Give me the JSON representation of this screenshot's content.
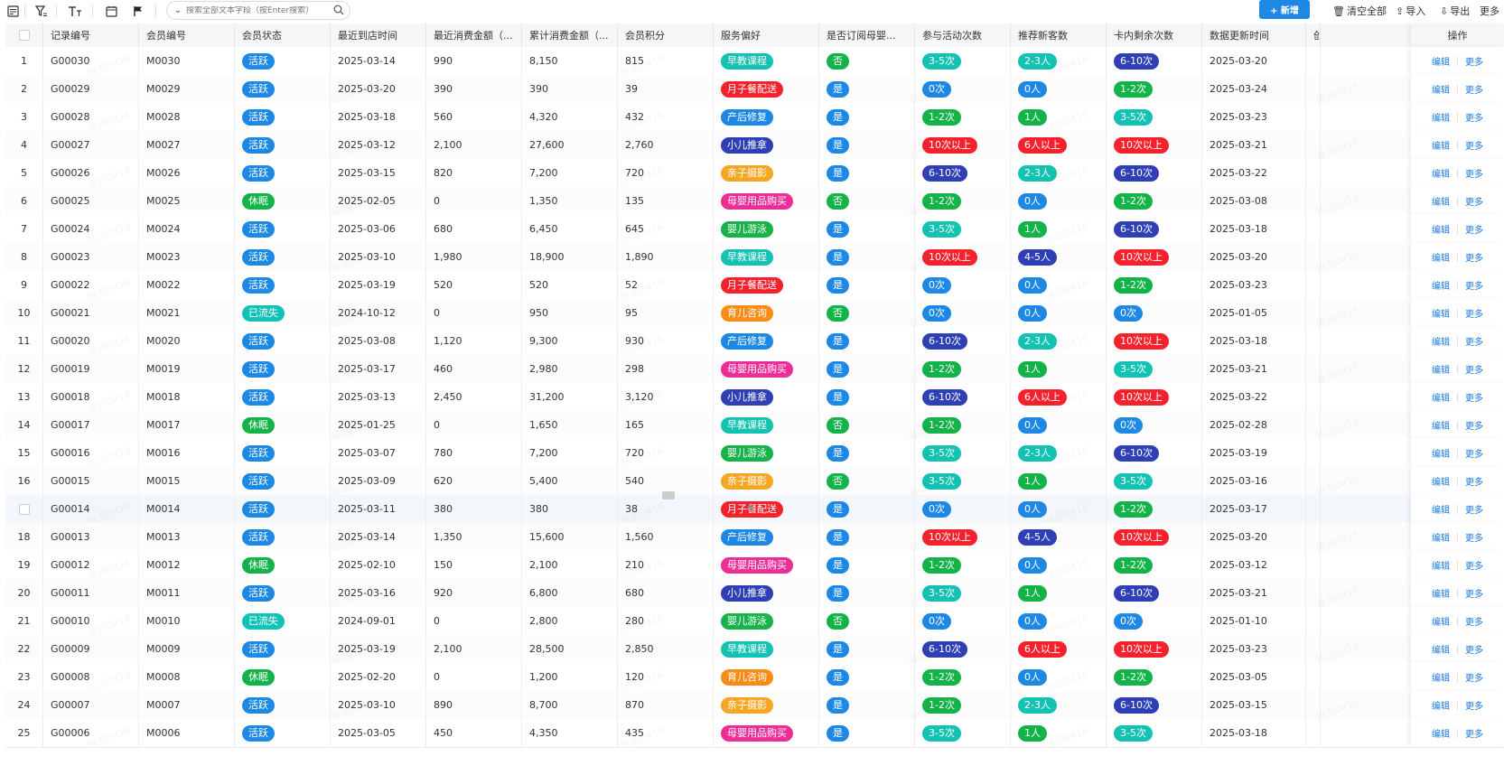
{
  "toolbar": {
    "icons": [
      "form-icon",
      "filter-icon",
      "text-size-icon",
      "calendar-icon",
      "flag-icon"
    ],
    "search_placeholder": "搜索全部文本字段（按Enter搜索）",
    "new_button": "+ 新增",
    "clear_all": "清空全部",
    "import": "导入",
    "export": "导出",
    "more": "更多"
  },
  "colors": {
    "活跃": "#1e88e5",
    "休眠": "#13b34a",
    "已流失": "#12c1b8",
    "早教课程": "#13c2b2",
    "月子餐配送": "#f5222d",
    "产后修复": "#1e88e5",
    "小儿推拿": "#2f3fb5",
    "亲子摄影": "#f5a623",
    "母婴用品购买": "#eb2f96",
    "婴儿游泳": "#17b34a",
    "育儿咨询": "#fa8c16",
    "是": "#1e88e5",
    "否": "#13b34a",
    "0次": "#1e88e5",
    "1-2次": "#13b34a",
    "3-5次": "#13c2b2",
    "6-10次": "#2f3fb5",
    "10次以上": "#f5222d",
    "0人": "#1e88e5",
    "1人": "#13b34a",
    "2-3人": "#13c2b2",
    "4-5人": "#2f3fb5",
    "6人以上": "#f5222d"
  },
  "headers": [
    "记录编号",
    "会员编号",
    "会员状态",
    "最近到店时间",
    "最近消费金额（...",
    "累计消费金额（...",
    "会员积分",
    "服务偏好",
    "是否订阅母婴...",
    "参与活动次数",
    "推荐新客数",
    "卡内剩余次数",
    "数据更新时间",
    "创",
    "操作"
  ],
  "ops": {
    "edit": "编辑",
    "more": "更多"
  },
  "watermark": "徐浩0416",
  "rows": [
    [
      "1",
      "G00030",
      "M0030",
      "活跃",
      "2025-03-14",
      "990",
      "8,150",
      "815",
      "早教课程",
      "否",
      "3-5次",
      "2-3人",
      "6-10次",
      "2025-03-20"
    ],
    [
      "2",
      "G00029",
      "M0029",
      "活跃",
      "2025-03-20",
      "390",
      "390",
      "39",
      "月子餐配送",
      "是",
      "0次",
      "0人",
      "1-2次",
      "2025-03-24"
    ],
    [
      "3",
      "G00028",
      "M0028",
      "活跃",
      "2025-03-18",
      "560",
      "4,320",
      "432",
      "产后修复",
      "是",
      "1-2次",
      "1人",
      "3-5次",
      "2025-03-23"
    ],
    [
      "4",
      "G00027",
      "M0027",
      "活跃",
      "2025-03-12",
      "2,100",
      "27,600",
      "2,760",
      "小儿推拿",
      "是",
      "10次以上",
      "6人以上",
      "10次以上",
      "2025-03-21"
    ],
    [
      "5",
      "G00026",
      "M0026",
      "活跃",
      "2025-03-15",
      "820",
      "7,200",
      "720",
      "亲子摄影",
      "是",
      "6-10次",
      "2-3人",
      "6-10次",
      "2025-03-22"
    ],
    [
      "6",
      "G00025",
      "M0025",
      "休眠",
      "2025-02-05",
      "0",
      "1,350",
      "135",
      "母婴用品购买",
      "否",
      "1-2次",
      "0人",
      "1-2次",
      "2025-03-08"
    ],
    [
      "7",
      "G00024",
      "M0024",
      "活跃",
      "2025-03-06",
      "680",
      "6,450",
      "645",
      "婴儿游泳",
      "是",
      "3-5次",
      "1人",
      "6-10次",
      "2025-03-18"
    ],
    [
      "8",
      "G00023",
      "M0023",
      "活跃",
      "2025-03-10",
      "1,980",
      "18,900",
      "1,890",
      "早教课程",
      "是",
      "10次以上",
      "4-5人",
      "10次以上",
      "2025-03-20"
    ],
    [
      "9",
      "G00022",
      "M0022",
      "活跃",
      "2025-03-19",
      "520",
      "520",
      "52",
      "月子餐配送",
      "是",
      "0次",
      "0人",
      "1-2次",
      "2025-03-23"
    ],
    [
      "10",
      "G00021",
      "M0021",
      "已流失",
      "2024-10-12",
      "0",
      "950",
      "95",
      "育儿咨询",
      "否",
      "0次",
      "0人",
      "0次",
      "2025-01-05"
    ],
    [
      "11",
      "G00020",
      "M0020",
      "活跃",
      "2025-03-08",
      "1,120",
      "9,300",
      "930",
      "产后修复",
      "是",
      "6-10次",
      "2-3人",
      "10次以上",
      "2025-03-18"
    ],
    [
      "12",
      "G00019",
      "M0019",
      "活跃",
      "2025-03-17",
      "460",
      "2,980",
      "298",
      "母婴用品购买",
      "是",
      "1-2次",
      "1人",
      "3-5次",
      "2025-03-21"
    ],
    [
      "13",
      "G00018",
      "M0018",
      "活跃",
      "2025-03-13",
      "2,450",
      "31,200",
      "3,120",
      "小儿推拿",
      "是",
      "6-10次",
      "6人以上",
      "10次以上",
      "2025-03-22"
    ],
    [
      "14",
      "G00017",
      "M0017",
      "休眠",
      "2025-01-25",
      "0",
      "1,650",
      "165",
      "早教课程",
      "否",
      "1-2次",
      "0人",
      "0次",
      "2025-02-28"
    ],
    [
      "15",
      "G00016",
      "M0016",
      "活跃",
      "2025-03-07",
      "780",
      "7,200",
      "720",
      "婴儿游泳",
      "是",
      "3-5次",
      "2-3人",
      "6-10次",
      "2025-03-19"
    ],
    [
      "16",
      "G00015",
      "M0015",
      "活跃",
      "2025-03-09",
      "620",
      "5,400",
      "540",
      "亲子摄影",
      "否",
      "3-5次",
      "1人",
      "3-5次",
      "2025-03-16"
    ],
    [
      "",
      "G00014",
      "M0014",
      "活跃",
      "2025-03-11",
      "380",
      "380",
      "38",
      "月子餐配送",
      "是",
      "0次",
      "0人",
      "1-2次",
      "2025-03-17"
    ],
    [
      "18",
      "G00013",
      "M0013",
      "活跃",
      "2025-03-14",
      "1,350",
      "15,600",
      "1,560",
      "产后修复",
      "是",
      "10次以上",
      "4-5人",
      "10次以上",
      "2025-03-20"
    ],
    [
      "19",
      "G00012",
      "M0012",
      "休眠",
      "2025-02-10",
      "150",
      "2,100",
      "210",
      "母婴用品购买",
      "是",
      "1-2次",
      "0人",
      "1-2次",
      "2025-03-12"
    ],
    [
      "20",
      "G00011",
      "M0011",
      "活跃",
      "2025-03-16",
      "920",
      "6,800",
      "680",
      "小儿推拿",
      "是",
      "3-5次",
      "1人",
      "6-10次",
      "2025-03-21"
    ],
    [
      "21",
      "G00010",
      "M0010",
      "已流失",
      "2024-09-01",
      "0",
      "2,800",
      "280",
      "婴儿游泳",
      "否",
      "0次",
      "0人",
      "0次",
      "2025-01-10"
    ],
    [
      "22",
      "G00009",
      "M0009",
      "活跃",
      "2025-03-19",
      "2,100",
      "28,500",
      "2,850",
      "早教课程",
      "是",
      "6-10次",
      "6人以上",
      "10次以上",
      "2025-03-23"
    ],
    [
      "23",
      "G00008",
      "M0008",
      "休眠",
      "2025-02-20",
      "0",
      "1,200",
      "120",
      "育儿咨询",
      "是",
      "1-2次",
      "0人",
      "1-2次",
      "2025-03-05"
    ],
    [
      "24",
      "G00007",
      "M0007",
      "活跃",
      "2025-03-10",
      "890",
      "8,700",
      "870",
      "亲子摄影",
      "是",
      "1-2次",
      "2-3人",
      "6-10次",
      "2025-03-15"
    ],
    [
      "25",
      "G00006",
      "M0006",
      "活跃",
      "2025-03-05",
      "450",
      "4,350",
      "435",
      "母婴用品购买",
      "是",
      "3-5次",
      "1人",
      "3-5次",
      "2025-03-18"
    ]
  ]
}
